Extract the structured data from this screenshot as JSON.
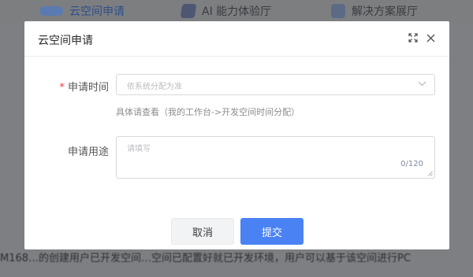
{
  "background": {
    "nav": [
      {
        "label": "云空间申请",
        "icon": "cloud-icon"
      },
      {
        "label": "AI 能力体验厅",
        "icon": "cube-icon"
      },
      {
        "label": "解决方案展厅",
        "icon": "document-icon"
      }
    ],
    "bottom_text": "M168…的创建用户已开发空间…空间已配置好就已开发环境，用户可以基于该空间进行PC"
  },
  "modal": {
    "title": "云空间申请",
    "fields": {
      "time": {
        "required_mark": "*",
        "label": "申请时间",
        "placeholder": "依系统分配为准",
        "hint": "具体请查看（我的工作台->开发空间时间分配）"
      },
      "use": {
        "label": "申请用途",
        "placeholder": "请填写",
        "counter": "0/120"
      }
    },
    "buttons": {
      "cancel": "取消",
      "submit": "提交"
    }
  },
  "colors": {
    "primary": "#4a82f4",
    "overlay": "#7e7f82",
    "required": "#e4393c"
  }
}
